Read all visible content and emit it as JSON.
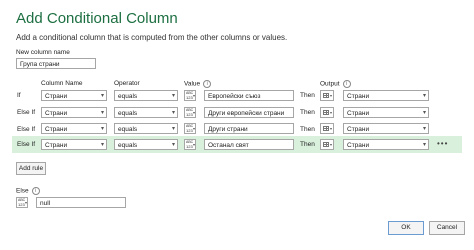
{
  "dialog": {
    "title": "Add Conditional Column",
    "subtitle": "Add a conditional column that is computed from the other columns or values.",
    "new_column_label": "New column name",
    "new_column_value": "Група страни"
  },
  "headers": {
    "column_name": "Column Name",
    "operator": "Operator",
    "value": "Value",
    "output": "Output",
    "info_glyph": "i"
  },
  "rows": [
    {
      "label": "If",
      "column": "Страни",
      "operator": "equals",
      "type_top": "ABC",
      "type_bottom": "123",
      "value": "Европейски съюз",
      "then": "Then",
      "output": "Страни"
    },
    {
      "label": "Else If",
      "column": "Страни",
      "operator": "equals",
      "type_top": "ABC",
      "type_bottom": "123",
      "value": "Други европейски страни",
      "then": "Then",
      "output": "Страни"
    },
    {
      "label": "Else If",
      "column": "Страни",
      "operator": "equals",
      "type_top": "ABC",
      "type_bottom": "123",
      "value": "Други страни",
      "then": "Then",
      "output": "Страни"
    },
    {
      "label": "Else If",
      "column": "Страни",
      "operator": "equals",
      "type_top": "ABC",
      "type_bottom": "123",
      "value": "Останал свят",
      "then": "Then",
      "output": "Страни",
      "more": "•••"
    }
  ],
  "add_rule": "Add rule",
  "else_section": {
    "label": "Else",
    "type_top": "ABC",
    "type_bottom": "123",
    "value": "null"
  },
  "footer": {
    "ok": "OK",
    "cancel": "Cancel"
  },
  "icons": {
    "dropdown": "chevron-down-icon",
    "info": "info-icon",
    "table": "table-icon",
    "more": "more-icon"
  },
  "colors": {
    "title": "#1d6f42",
    "highlight_row": "#d9f0dc",
    "border": "#a6a6a6"
  }
}
